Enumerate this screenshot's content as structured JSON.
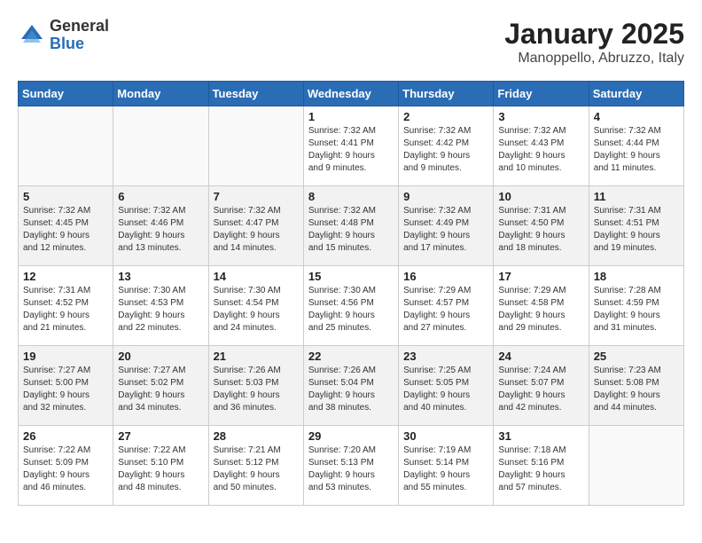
{
  "header": {
    "logo_general": "General",
    "logo_blue": "Blue",
    "month_title": "January 2025",
    "location": "Manoppello, Abruzzo, Italy"
  },
  "days_of_week": [
    "Sunday",
    "Monday",
    "Tuesday",
    "Wednesday",
    "Thursday",
    "Friday",
    "Saturday"
  ],
  "weeks": [
    [
      {
        "day": "",
        "info": ""
      },
      {
        "day": "",
        "info": ""
      },
      {
        "day": "",
        "info": ""
      },
      {
        "day": "1",
        "info": "Sunrise: 7:32 AM\nSunset: 4:41 PM\nDaylight: 9 hours\nand 9 minutes."
      },
      {
        "day": "2",
        "info": "Sunrise: 7:32 AM\nSunset: 4:42 PM\nDaylight: 9 hours\nand 9 minutes."
      },
      {
        "day": "3",
        "info": "Sunrise: 7:32 AM\nSunset: 4:43 PM\nDaylight: 9 hours\nand 10 minutes."
      },
      {
        "day": "4",
        "info": "Sunrise: 7:32 AM\nSunset: 4:44 PM\nDaylight: 9 hours\nand 11 minutes."
      }
    ],
    [
      {
        "day": "5",
        "info": "Sunrise: 7:32 AM\nSunset: 4:45 PM\nDaylight: 9 hours\nand 12 minutes."
      },
      {
        "day": "6",
        "info": "Sunrise: 7:32 AM\nSunset: 4:46 PM\nDaylight: 9 hours\nand 13 minutes."
      },
      {
        "day": "7",
        "info": "Sunrise: 7:32 AM\nSunset: 4:47 PM\nDaylight: 9 hours\nand 14 minutes."
      },
      {
        "day": "8",
        "info": "Sunrise: 7:32 AM\nSunset: 4:48 PM\nDaylight: 9 hours\nand 15 minutes."
      },
      {
        "day": "9",
        "info": "Sunrise: 7:32 AM\nSunset: 4:49 PM\nDaylight: 9 hours\nand 17 minutes."
      },
      {
        "day": "10",
        "info": "Sunrise: 7:31 AM\nSunset: 4:50 PM\nDaylight: 9 hours\nand 18 minutes."
      },
      {
        "day": "11",
        "info": "Sunrise: 7:31 AM\nSunset: 4:51 PM\nDaylight: 9 hours\nand 19 minutes."
      }
    ],
    [
      {
        "day": "12",
        "info": "Sunrise: 7:31 AM\nSunset: 4:52 PM\nDaylight: 9 hours\nand 21 minutes."
      },
      {
        "day": "13",
        "info": "Sunrise: 7:30 AM\nSunset: 4:53 PM\nDaylight: 9 hours\nand 22 minutes."
      },
      {
        "day": "14",
        "info": "Sunrise: 7:30 AM\nSunset: 4:54 PM\nDaylight: 9 hours\nand 24 minutes."
      },
      {
        "day": "15",
        "info": "Sunrise: 7:30 AM\nSunset: 4:56 PM\nDaylight: 9 hours\nand 25 minutes."
      },
      {
        "day": "16",
        "info": "Sunrise: 7:29 AM\nSunset: 4:57 PM\nDaylight: 9 hours\nand 27 minutes."
      },
      {
        "day": "17",
        "info": "Sunrise: 7:29 AM\nSunset: 4:58 PM\nDaylight: 9 hours\nand 29 minutes."
      },
      {
        "day": "18",
        "info": "Sunrise: 7:28 AM\nSunset: 4:59 PM\nDaylight: 9 hours\nand 31 minutes."
      }
    ],
    [
      {
        "day": "19",
        "info": "Sunrise: 7:27 AM\nSunset: 5:00 PM\nDaylight: 9 hours\nand 32 minutes."
      },
      {
        "day": "20",
        "info": "Sunrise: 7:27 AM\nSunset: 5:02 PM\nDaylight: 9 hours\nand 34 minutes."
      },
      {
        "day": "21",
        "info": "Sunrise: 7:26 AM\nSunset: 5:03 PM\nDaylight: 9 hours\nand 36 minutes."
      },
      {
        "day": "22",
        "info": "Sunrise: 7:26 AM\nSunset: 5:04 PM\nDaylight: 9 hours\nand 38 minutes."
      },
      {
        "day": "23",
        "info": "Sunrise: 7:25 AM\nSunset: 5:05 PM\nDaylight: 9 hours\nand 40 minutes."
      },
      {
        "day": "24",
        "info": "Sunrise: 7:24 AM\nSunset: 5:07 PM\nDaylight: 9 hours\nand 42 minutes."
      },
      {
        "day": "25",
        "info": "Sunrise: 7:23 AM\nSunset: 5:08 PM\nDaylight: 9 hours\nand 44 minutes."
      }
    ],
    [
      {
        "day": "26",
        "info": "Sunrise: 7:22 AM\nSunset: 5:09 PM\nDaylight: 9 hours\nand 46 minutes."
      },
      {
        "day": "27",
        "info": "Sunrise: 7:22 AM\nSunset: 5:10 PM\nDaylight: 9 hours\nand 48 minutes."
      },
      {
        "day": "28",
        "info": "Sunrise: 7:21 AM\nSunset: 5:12 PM\nDaylight: 9 hours\nand 50 minutes."
      },
      {
        "day": "29",
        "info": "Sunrise: 7:20 AM\nSunset: 5:13 PM\nDaylight: 9 hours\nand 53 minutes."
      },
      {
        "day": "30",
        "info": "Sunrise: 7:19 AM\nSunset: 5:14 PM\nDaylight: 9 hours\nand 55 minutes."
      },
      {
        "day": "31",
        "info": "Sunrise: 7:18 AM\nSunset: 5:16 PM\nDaylight: 9 hours\nand 57 minutes."
      },
      {
        "day": "",
        "info": ""
      }
    ]
  ]
}
